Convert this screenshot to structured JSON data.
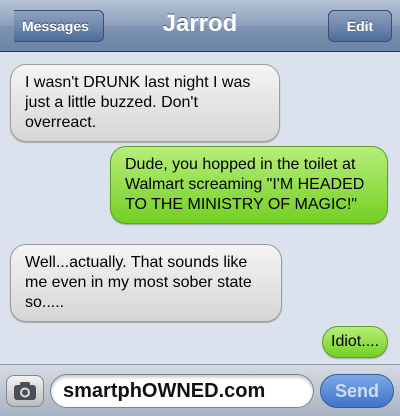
{
  "header": {
    "back_label": "Messages",
    "title": "Jarrod",
    "edit_label": "Edit"
  },
  "messages": [
    {
      "side": "received",
      "text": "I wasn't DRUNK last night I was just a little buzzed. Don't overreact."
    },
    {
      "side": "sent",
      "text": "Dude, you hopped in the toilet at Walmart screaming \"I'M HEADED TO THE MINISTRY OF MAGIC!\""
    },
    {
      "side": "received",
      "text": "Well...actually. That sounds like me even in my most sober state so....."
    },
    {
      "side": "sent",
      "text": "Idiot...."
    }
  ],
  "composer": {
    "camera_icon": "camera-icon",
    "input_value": "smartphOWNED.com",
    "send_label": "Send"
  },
  "colors": {
    "received_bubble": "#e6e6e6",
    "sent_bubble": "#8fdc44",
    "background": "#dbe2ed",
    "navbar": "#8da1bd"
  }
}
